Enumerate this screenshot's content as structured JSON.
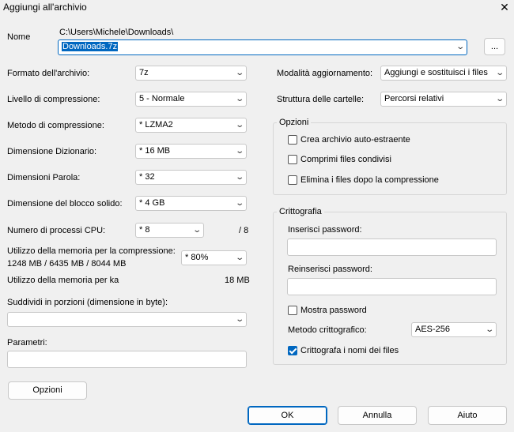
{
  "window": {
    "title": "Aggiungi all'archivio",
    "close_icon": "close-icon"
  },
  "name": {
    "label": "Nome",
    "path": "C:\\Users\\Michele\\Downloads\\",
    "value": "Downloads.7z",
    "browse_label": "..."
  },
  "left": {
    "format_label": "Formato dell'archivio:",
    "format_value": "7z",
    "level_label": "Livello di compressione:",
    "level_value": "5 - Normale",
    "method_label": "Metodo di compressione:",
    "method_value": "* LZMA2",
    "dict_label": "Dimensione Dizionario:",
    "dict_value": "* 16 MB",
    "word_label": "Dimensioni Parola:",
    "word_value": "* 32",
    "solid_label": "Dimensione del blocco solido:",
    "solid_value": "* 4 GB",
    "threads_label": "Numero di processi CPU:",
    "threads_value": "* 8",
    "threads_max": "/ 8",
    "mem_label": "Utilizzo della memoria per la compressione:",
    "mem_detail": "1248 MB / 6435 MB / 8044 MB",
    "mem_value": "* 80%",
    "mem_decomp_label": "Utilizzo della memoria per ka",
    "mem_decomp_value": "18 MB",
    "split_label": "Suddividi in porzioni (dimensione in byte):",
    "split_value": "",
    "params_label": "Parametri:",
    "params_value": "",
    "options_button": "Opzioni"
  },
  "right": {
    "update_label": "Modalità aggiornamento:",
    "update_value": "Aggiungi e sostituisci i files",
    "structure_label": "Struttura delle cartelle:",
    "structure_value": "Percorsi relativi",
    "options_group": "Opzioni",
    "opt_sfx": {
      "label": "Crea archivio auto-estraente",
      "checked": false
    },
    "opt_shared": {
      "label": "Comprimi files condivisi",
      "checked": false
    },
    "opt_delete": {
      "label": "Elimina i files dopo la compressione",
      "checked": false
    },
    "crypto_group": "Crittografia",
    "pwd_label": "Inserisci password:",
    "pwd2_label": "Reinserisci password:",
    "show_pwd": {
      "label": "Mostra password",
      "checked": false
    },
    "method_label": "Metodo crittografico:",
    "method_value": "AES-256",
    "encrypt_names": {
      "label": "Crittografa i nomi dei files",
      "checked": true
    }
  },
  "buttons": {
    "ok": "OK",
    "cancel": "Annulla",
    "help": "Aiuto"
  },
  "colors": {
    "accent": "#0067c0",
    "background": "#f0f0f0"
  }
}
